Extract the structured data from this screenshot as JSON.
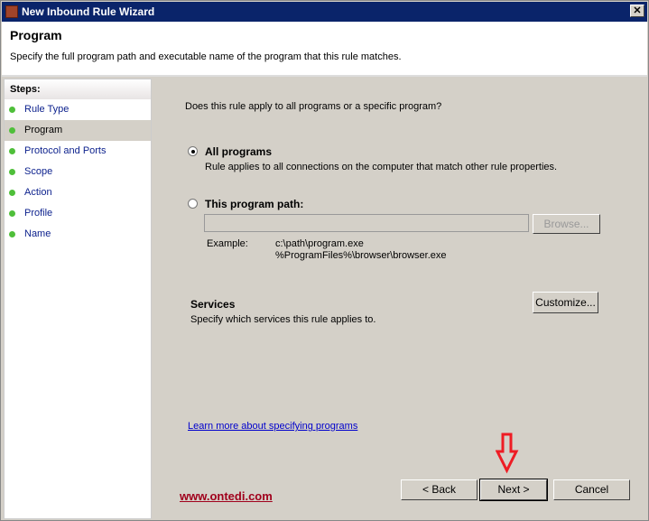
{
  "window": {
    "title": "New Inbound Rule Wizard",
    "close": "✕"
  },
  "header": {
    "title": "Program",
    "subtitle": "Specify the full program path and executable name of the program that this rule matches."
  },
  "steps": {
    "heading": "Steps:",
    "items": [
      {
        "label": "Rule Type"
      },
      {
        "label": "Program"
      },
      {
        "label": "Protocol and Ports"
      },
      {
        "label": "Scope"
      },
      {
        "label": "Action"
      },
      {
        "label": "Profile"
      },
      {
        "label": "Name"
      }
    ]
  },
  "main": {
    "question": "Does this rule apply to all programs or a specific program?",
    "all_programs": {
      "label": "All programs",
      "desc": "Rule applies to all connections on the computer that match other rule properties.",
      "selected": true
    },
    "this_program": {
      "label": "This program path:",
      "value": "",
      "browse": "Browse..."
    },
    "example_label": "Example:",
    "example_1": "c:\\path\\program.exe",
    "example_2": "%ProgramFiles%\\browser\\browser.exe",
    "services": {
      "title": "Services",
      "desc": "Specify which services this rule applies to.",
      "button": "Customize..."
    },
    "learn_more": "Learn more about specifying programs",
    "watermark": "www.ontedi.com"
  },
  "footer": {
    "back": "< Back",
    "next": "Next >",
    "cancel": "Cancel"
  },
  "colors": {
    "arrow": "#ee1c24",
    "watermark": "#a0001c"
  }
}
